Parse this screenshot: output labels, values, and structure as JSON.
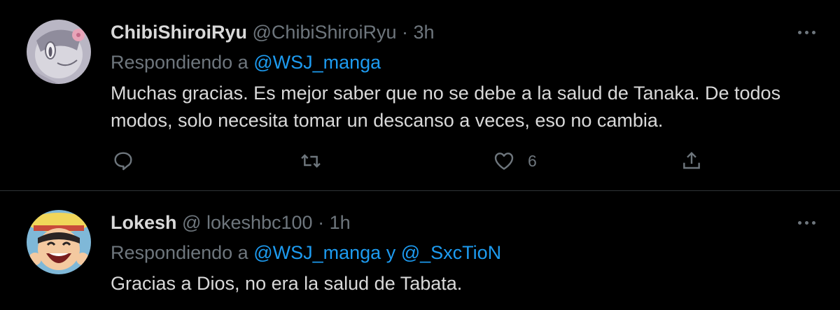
{
  "tweets": [
    {
      "display_name": "ChibiShiroiRyu",
      "handle": "@ChibiShiroiRyu",
      "dot": "·",
      "time": "3h",
      "reply_prefix": "Respondiendo a",
      "mentions": [
        "@WSJ_manga"
      ],
      "mention_joiner": "",
      "text": "Muchas gracias. Es mejor saber que no se debe a la salud de Tanaka. De todos modos, solo necesita tomar un descanso a veces, eso no cambia.",
      "actions": {
        "reply_icon": "comment-icon",
        "retweet_icon": "retweet-icon",
        "like_icon": "heart-icon",
        "like_count": "6",
        "share_icon": "share-icon"
      }
    },
    {
      "display_name": "Lokesh",
      "handle": "@ lokeshbc100",
      "dot": "·",
      "time": "1h",
      "reply_prefix": "Respondiendo a",
      "mentions": [
        "@WSJ_manga",
        "@_SxcTioN"
      ],
      "mention_joiner": "y",
      "text": "Gracias a Dios, no era la salud de Tabata."
    }
  ],
  "colors": {
    "background": "#000000",
    "text": "#d9d9d9",
    "muted": "#6e767d",
    "link": "#1d9bf0",
    "divider": "#2f3336"
  },
  "icons": {
    "more": "more-options-icon"
  }
}
